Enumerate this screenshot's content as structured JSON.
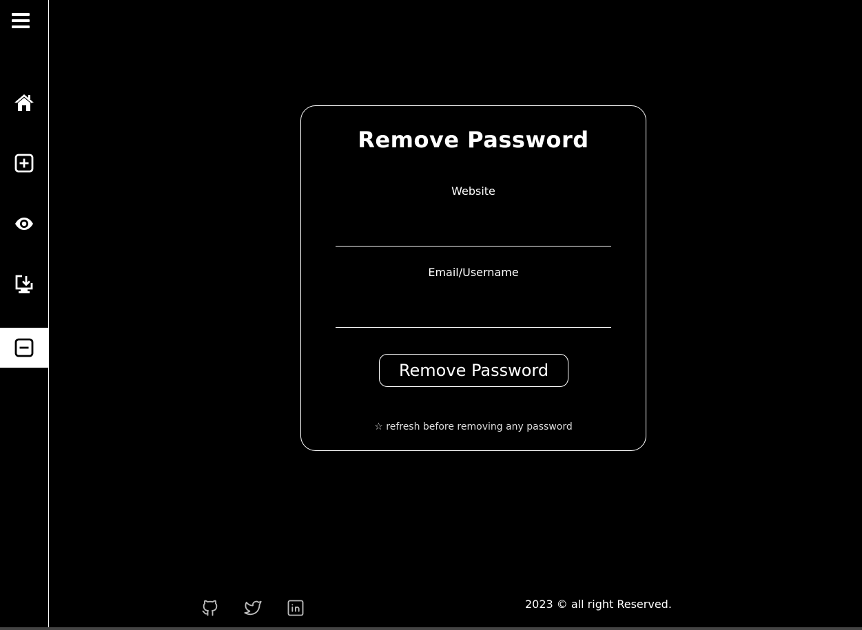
{
  "sidebar": {
    "menu_icon": "hamburger-menu-icon",
    "items": [
      {
        "name": "home",
        "icon": "home-icon",
        "active": false
      },
      {
        "name": "add-password",
        "icon": "plus-square-icon",
        "active": false
      },
      {
        "name": "view-passwords",
        "icon": "eye-icon",
        "active": false
      },
      {
        "name": "download-passwords",
        "icon": "download-monitor-icon",
        "active": false
      },
      {
        "name": "remove-password",
        "icon": "minus-square-icon",
        "active": true
      }
    ]
  },
  "form": {
    "title": "Remove Password",
    "website_label": "Website",
    "website_value": "",
    "email_label": "Email/Username",
    "email_value": "",
    "submit_label": "Remove Password",
    "note": "☆ refresh before removing any password"
  },
  "footer": {
    "icons": [
      "github-icon",
      "twitter-icon",
      "linkedin-icon"
    ],
    "copyright": "2023 © all right Reserved."
  },
  "colors": {
    "background": "#000000",
    "foreground": "#ffffff",
    "active_nav_bg": "#ffffff"
  }
}
